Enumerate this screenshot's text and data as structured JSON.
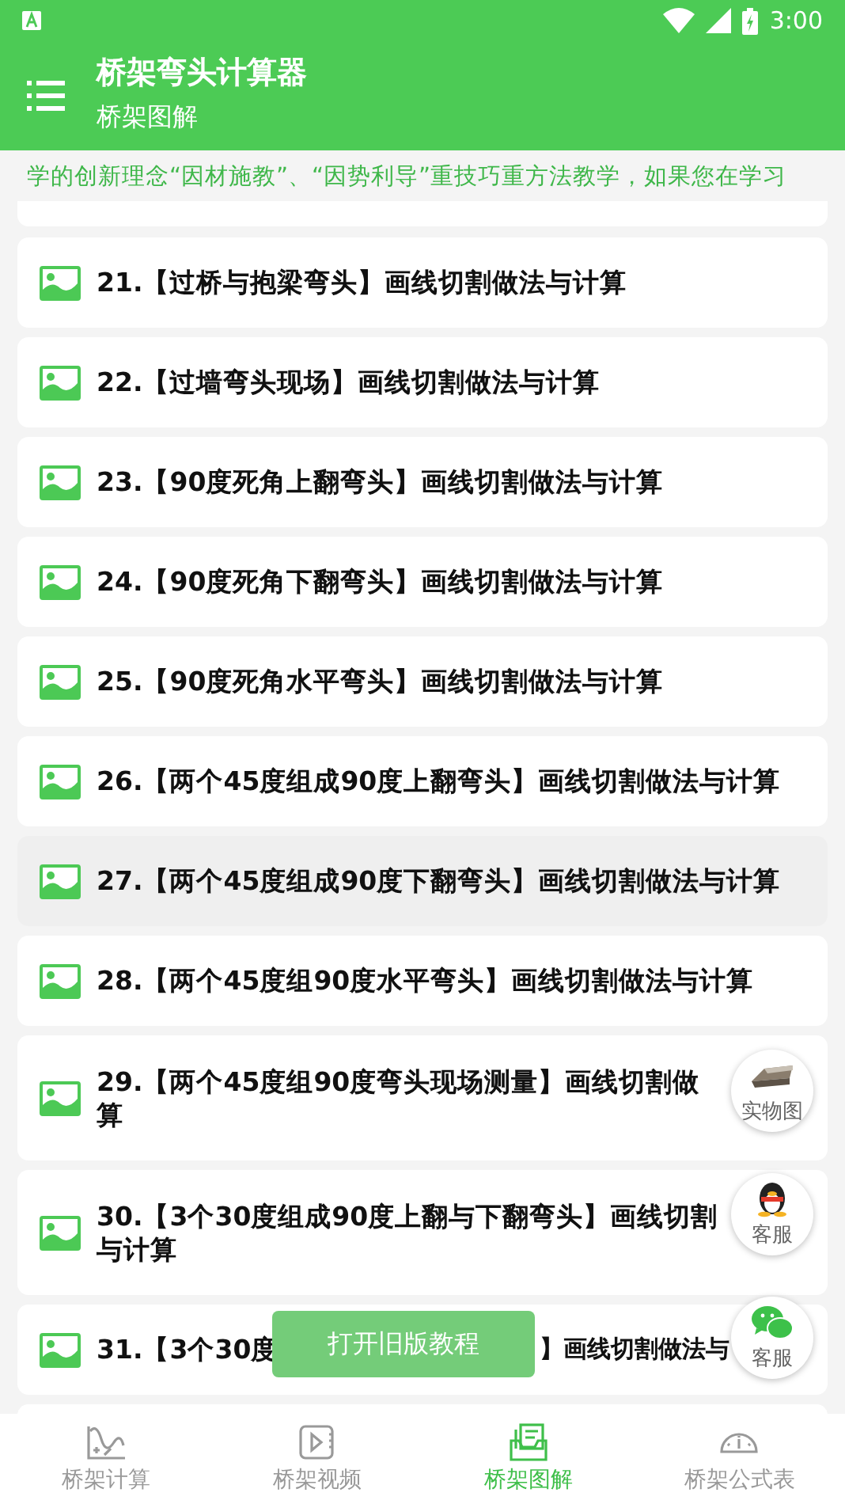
{
  "status_bar": {
    "time": "3:00"
  },
  "app_bar": {
    "title": "桥架弯头计算器",
    "subtitle": "桥架图解"
  },
  "marquee": {
    "text": "学的创新理念“因材施教”、“因势利导”重技巧重方法教学，如果您在学习"
  },
  "items": [
    {
      "lines": [
        "21.【过桥与抱梁弯头】画线切割做法与计算"
      ],
      "selected": false
    },
    {
      "lines": [
        "22.【过墙弯头现场】画线切割做法与计算"
      ],
      "selected": false
    },
    {
      "lines": [
        "23.【90度死角上翻弯头】画线切割做法与计算"
      ],
      "selected": false
    },
    {
      "lines": [
        "24.【90度死角下翻弯头】画线切割做法与计算"
      ],
      "selected": false
    },
    {
      "lines": [
        "25.【90度死角水平弯头】画线切割做法与计算"
      ],
      "selected": false
    },
    {
      "lines": [
        "26.【两个45度组成90度上翻弯头】画线切割做法与计算"
      ],
      "selected": false
    },
    {
      "lines": [
        "27.【两个45度组成90度下翻弯头】画线切割做法与计算"
      ],
      "selected": true
    },
    {
      "lines": [
        "28.【两个45度组90度水平弯头】画线切割做法与计算"
      ],
      "selected": false
    },
    {
      "lines": [
        "29.【两个45度组90度弯头现场测量】画线切割做",
        "算"
      ],
      "selected": false
    },
    {
      "lines": [
        "30.【3个30度组成90度上翻与下翻弯头】画线切割",
        "与计算"
      ],
      "selected": false
    },
    {
      "segments": [
        "31.【3个30度",
        "】画线切割做法与"
      ],
      "selected": false
    }
  ],
  "floating_buttons": [
    {
      "kind": "photo",
      "label": "实物图"
    },
    {
      "kind": "penguin",
      "label": "客服"
    },
    {
      "kind": "chat",
      "label": "客服"
    }
  ],
  "toast": {
    "text": "打开旧版教程"
  },
  "bottom_nav": [
    {
      "kind": "chart",
      "label": "桥架计算",
      "selected": false
    },
    {
      "kind": "video",
      "label": "桥架视频",
      "selected": false
    },
    {
      "kind": "doc",
      "label": "桥架图解",
      "selected": true
    },
    {
      "kind": "gauge",
      "label": "桥架公式表",
      "selected": false
    }
  ]
}
